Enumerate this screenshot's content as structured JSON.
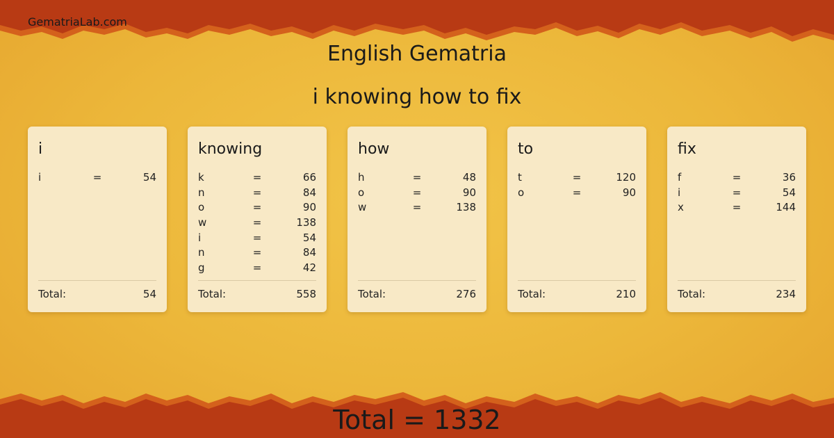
{
  "site_name": "GematriaLab.com",
  "title": "English Gematria",
  "phrase": "i knowing how to fix",
  "total_label": "Total:",
  "grand_total": "Total = 1332",
  "colors": {
    "band": "#b83a14",
    "band_edge": "#d4611c",
    "card": "#f8e9c6",
    "bg": "#ecb73a"
  },
  "words": [
    {
      "word": "i",
      "total": "54",
      "letters": [
        {
          "l": "i",
          "eq": "=",
          "v": "54"
        }
      ]
    },
    {
      "word": "knowing",
      "total": "558",
      "letters": [
        {
          "l": "k",
          "eq": "=",
          "v": "66"
        },
        {
          "l": "n",
          "eq": "=",
          "v": "84"
        },
        {
          "l": "o",
          "eq": "=",
          "v": "90"
        },
        {
          "l": "w",
          "eq": "=",
          "v": "138"
        },
        {
          "l": "i",
          "eq": "=",
          "v": "54"
        },
        {
          "l": "n",
          "eq": "=",
          "v": "84"
        },
        {
          "l": "g",
          "eq": "=",
          "v": "42"
        }
      ]
    },
    {
      "word": "how",
      "total": "276",
      "letters": [
        {
          "l": "h",
          "eq": "=",
          "v": "48"
        },
        {
          "l": "o",
          "eq": "=",
          "v": "90"
        },
        {
          "l": "w",
          "eq": "=",
          "v": "138"
        }
      ]
    },
    {
      "word": "to",
      "total": "210",
      "letters": [
        {
          "l": "t",
          "eq": "=",
          "v": "120"
        },
        {
          "l": "o",
          "eq": "=",
          "v": "90"
        }
      ]
    },
    {
      "word": "fix",
      "total": "234",
      "letters": [
        {
          "l": "f",
          "eq": "=",
          "v": "36"
        },
        {
          "l": "i",
          "eq": "=",
          "v": "54"
        },
        {
          "l": "x",
          "eq": "=",
          "v": "144"
        }
      ]
    }
  ]
}
